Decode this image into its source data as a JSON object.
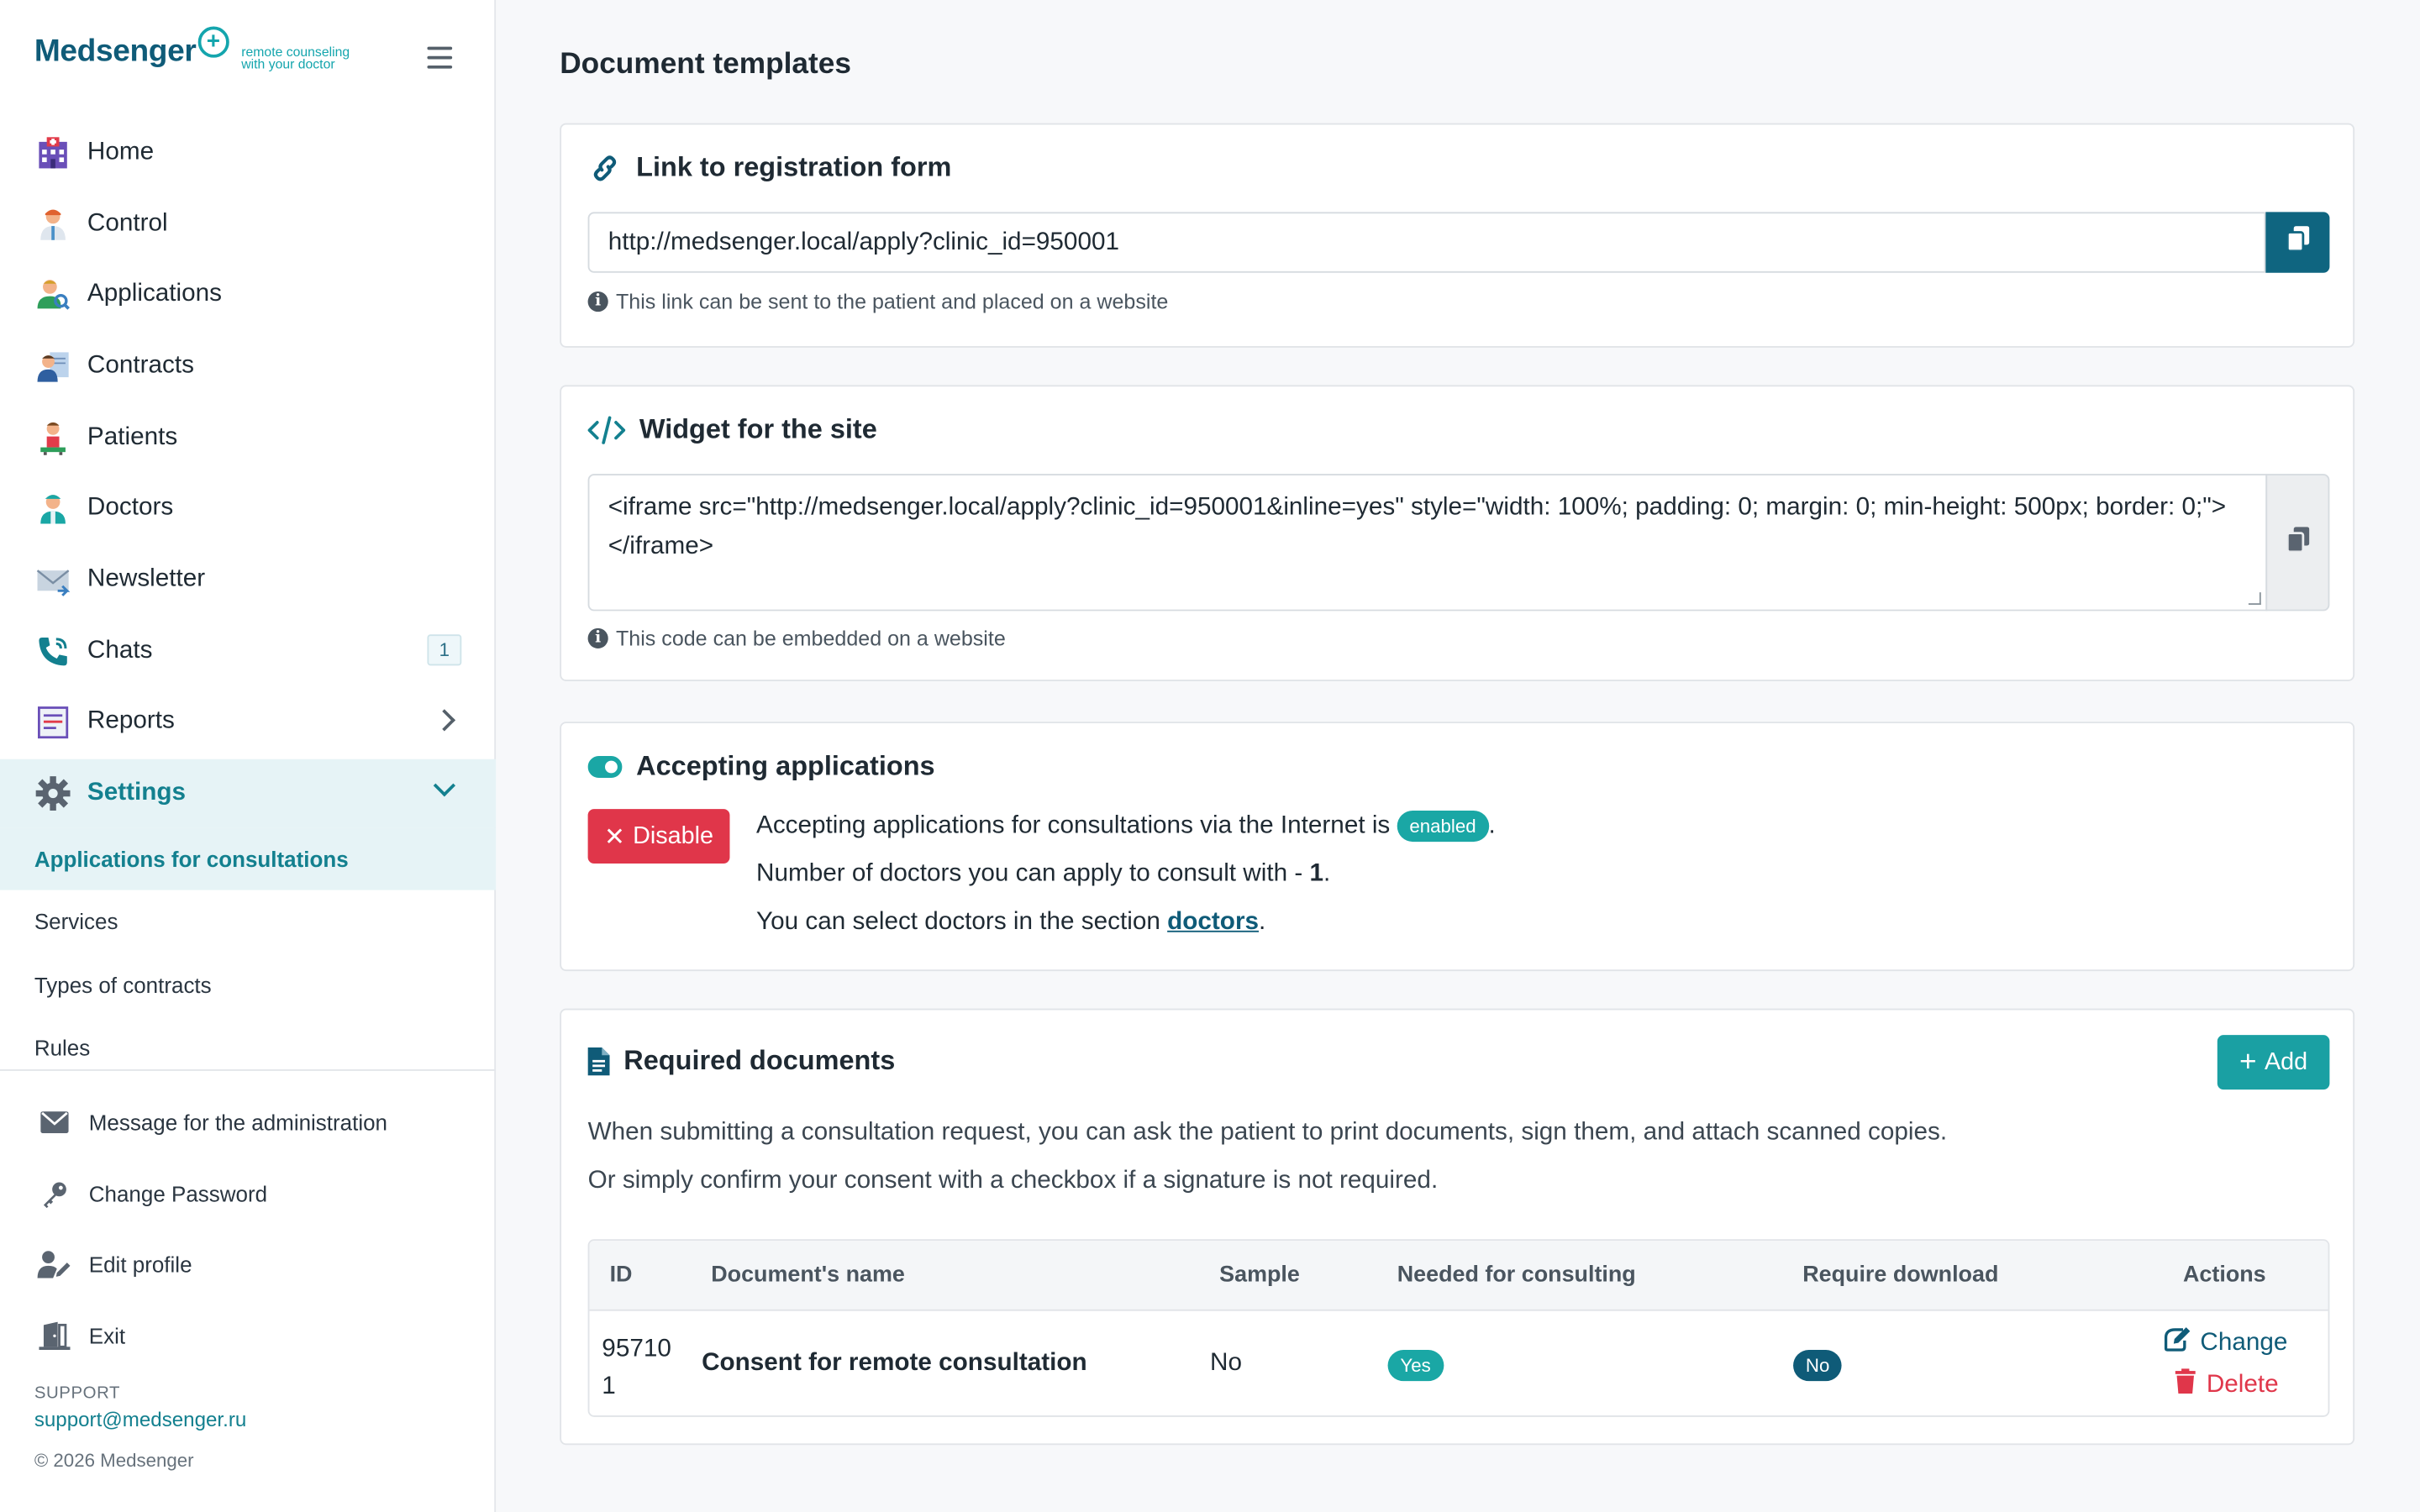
{
  "brand": {
    "name": "Medsenger",
    "plus": "+",
    "tagline": "remote counseling with your doctor"
  },
  "sidebar": {
    "items": [
      {
        "label": "Home",
        "icon": "hospital-icon"
      },
      {
        "label": "Control",
        "icon": "doctor-icon"
      },
      {
        "label": "Applications",
        "icon": "user-search-icon"
      },
      {
        "label": "Contracts",
        "icon": "contract-icon"
      },
      {
        "label": "Patients",
        "icon": "patient-icon"
      },
      {
        "label": "Doctors",
        "icon": "nurse-icon"
      },
      {
        "label": "Newsletter",
        "icon": "envelope-icon"
      },
      {
        "label": "Chats",
        "icon": "phone-icon",
        "badge": "1"
      },
      {
        "label": "Reports",
        "icon": "report-icon"
      },
      {
        "label": "Settings",
        "icon": "gear-icon"
      }
    ],
    "sub_items": [
      {
        "label": "Applications for consultations"
      },
      {
        "label": "Services"
      },
      {
        "label": "Types of contracts"
      },
      {
        "label": "Rules"
      }
    ],
    "utility_items": [
      {
        "label": "Message for the administration",
        "icon": "envelope-icon"
      },
      {
        "label": "Change Password",
        "icon": "key-icon"
      },
      {
        "label": "Edit profile",
        "icon": "user-edit-icon"
      },
      {
        "label": "Exit",
        "icon": "door-exit-icon"
      }
    ],
    "support_label": "SUPPORT",
    "support_email": "support@medsenger.ru",
    "copyright": "© 2026 Medsenger"
  },
  "page": {
    "title": "Document templates"
  },
  "registration_link": {
    "title": "Link to registration form",
    "url": "http://medsenger.local/apply?clinic_id=950001",
    "hint": "This link can be sent to the patient and placed on a website"
  },
  "widget": {
    "title": "Widget for the site",
    "code": "<iframe src=\"http://medsenger.local/apply?clinic_id=950001&inline=yes\" style=\"width: 100%; padding: 0; margin: 0; min-height: 500px; border: 0;\"></iframe>",
    "hint": "This code can be embedded on a website"
  },
  "accepting": {
    "title": "Accepting applications",
    "disable_label": "Disable",
    "line1_prefix": "Accepting applications for consultations via the Internet is",
    "status": "enabled",
    "line1_suffix": ".",
    "line2_prefix": "Number of doctors you can apply to consult with - ",
    "doctor_count": "1",
    "line2_suffix": ".",
    "line3_prefix": "You can select doctors in the section ",
    "line3_link": "doctors",
    "line3_suffix": "."
  },
  "required_docs": {
    "title": "Required documents",
    "add_label": "Add",
    "desc1": "When submitting a consultation request, you can ask the patient to print documents, sign them, and attach scanned copies.",
    "desc2": "Or simply confirm your consent with a checkbox if a signature is not required.",
    "columns": [
      "ID",
      "Document's name",
      "Sample",
      "Needed for consulting",
      "Require download",
      "Actions"
    ],
    "rows": [
      {
        "id_line1": "95710",
        "id_line2": "1",
        "name": "Consent for remote consultation",
        "sample": "No",
        "needed": "Yes",
        "download": "No",
        "change_label": "Change",
        "delete_label": "Delete"
      }
    ]
  },
  "colors": {
    "accent": "#13808f",
    "brand": "#0f5b78",
    "teal": "#1aa7a5",
    "danger": "#e0364a"
  }
}
